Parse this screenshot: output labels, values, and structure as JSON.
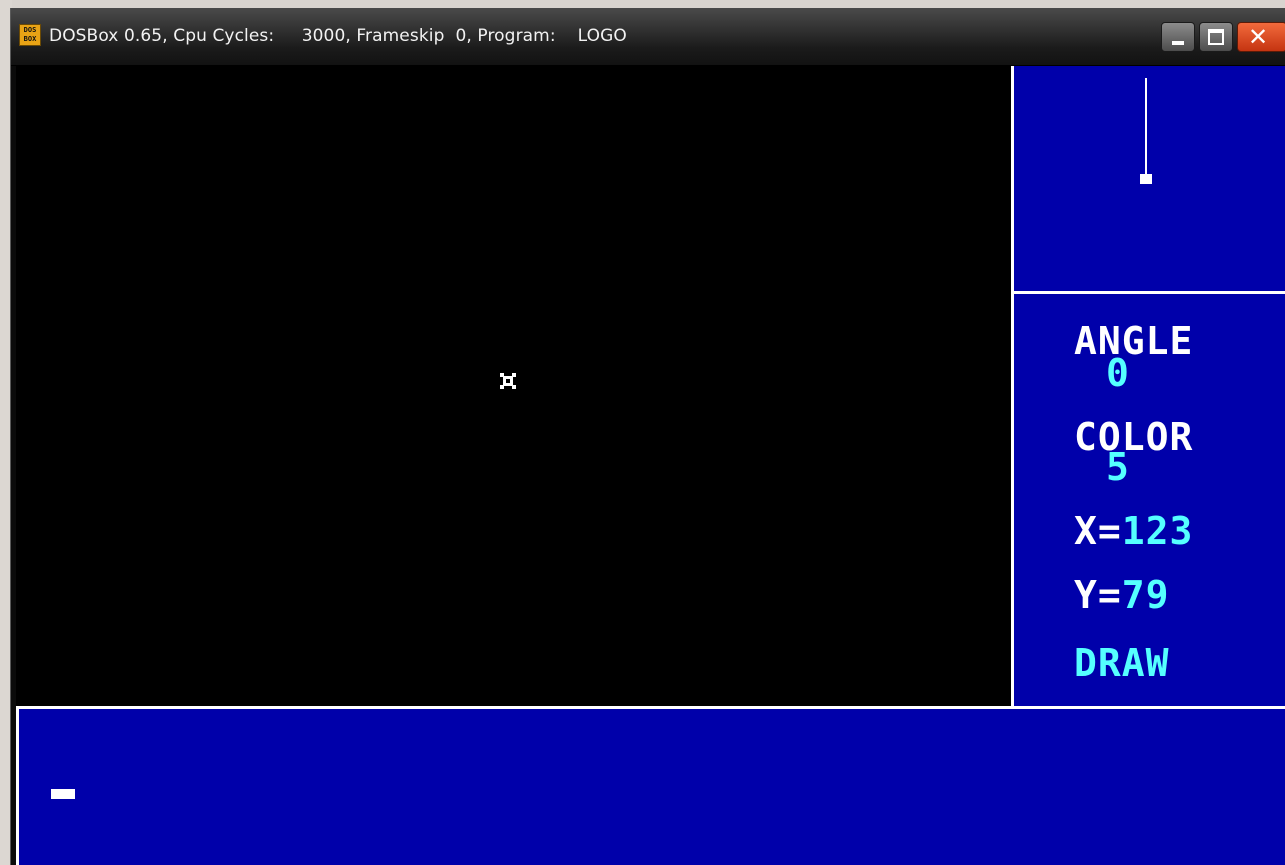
{
  "window": {
    "title": "DOSBox 0.65, Cpu Cycles:     3000, Frameskip  0, Program:    LOGO",
    "icon_label": "DOS BOX",
    "buttons": [
      "minimize-icon",
      "maximize-icon",
      "close-icon"
    ]
  },
  "compass": {
    "heading_degrees": 0
  },
  "status": {
    "angle_label": "ANGLE",
    "angle_value": "0",
    "color_label": "COLOR",
    "color_value": "5",
    "x_label": "X=",
    "x_value": "123",
    "y_label": "Y=",
    "y_value": "79",
    "pen_mode": "DRAW"
  },
  "command_line": {
    "text": ""
  },
  "colors": {
    "panel_blue": "#0000aa",
    "value_cyan": "#55ffff",
    "label_white": "#ffffff",
    "canvas_black": "#000000"
  }
}
